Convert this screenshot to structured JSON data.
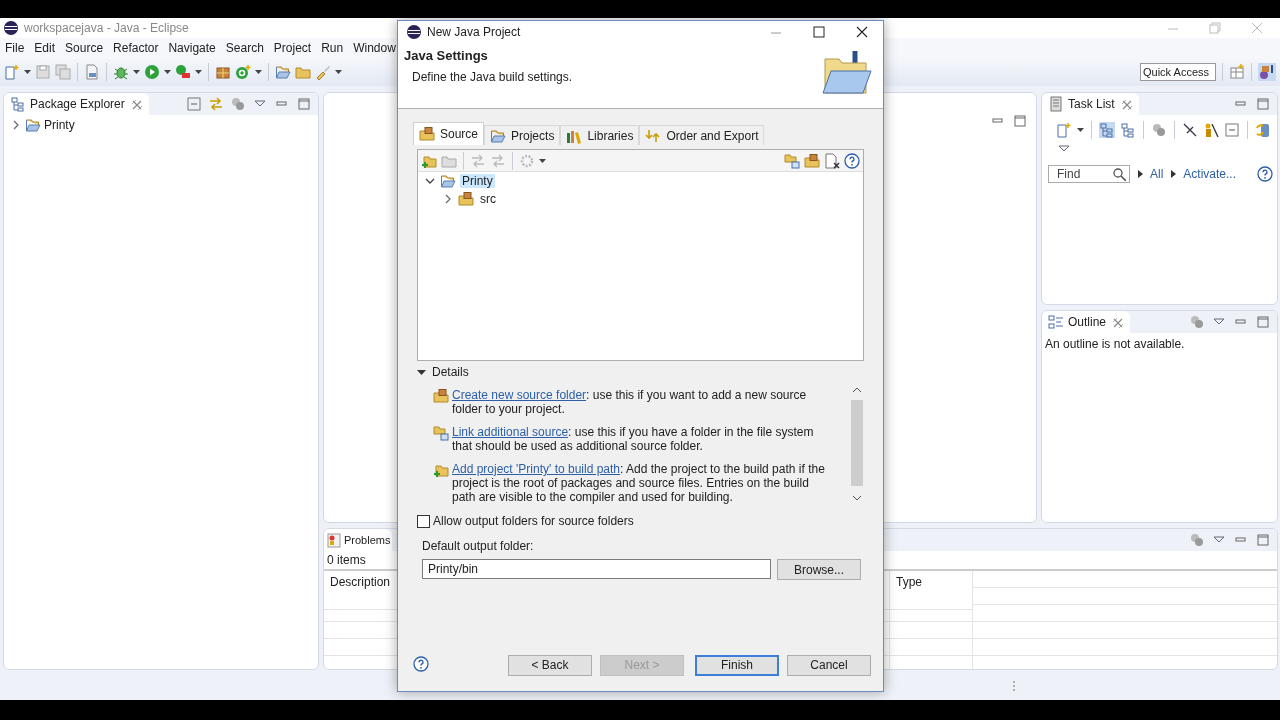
{
  "window": {
    "title": "workspacejava - Java - Eclipse"
  },
  "menu": [
    "File",
    "Edit",
    "Source",
    "Refactor",
    "Navigate",
    "Search",
    "Project",
    "Run",
    "Window"
  ],
  "quick_access": {
    "placeholder": "Quick Access"
  },
  "package_explorer": {
    "title": "Package Explorer",
    "tree": [
      {
        "label": "Printy",
        "expanded": false
      }
    ]
  },
  "task_list": {
    "title": "Task List",
    "find": {
      "placeholder": "Find"
    },
    "links": [
      "All",
      "Activate..."
    ]
  },
  "outline": {
    "title": "Outline",
    "message": "An outline is not available."
  },
  "problems": {
    "title": "Problems",
    "count": "0 items",
    "columns": [
      "Description",
      "Type"
    ]
  },
  "dialog": {
    "title": "New Java Project",
    "heading": "Java Settings",
    "description": "Define the Java build settings.",
    "tabs": [
      {
        "label": "Source",
        "selected": true
      },
      {
        "label": "Projects",
        "selected": false
      },
      {
        "label": "Libraries",
        "selected": false
      },
      {
        "label": "Order and Export",
        "selected": false
      }
    ],
    "tree": [
      {
        "label": "Printy",
        "expanded": true,
        "selected": true,
        "children": [
          {
            "label": "src",
            "expanded": false,
            "selected": false
          }
        ]
      }
    ],
    "details": {
      "title": "Details",
      "expanded": true,
      "items": [
        {
          "link": "Create new source folder",
          "text": ": use this if you want to add a new source folder to your project."
        },
        {
          "link": "Link additional source",
          "text": ": use this if you have a folder in the file system that should be used as additional source folder."
        },
        {
          "link": "Add project 'Printy' to build path",
          "text": ": Add the project to the build path if the project is the root of packages and source files. Entries on the build path are visible to the compiler and used for building."
        }
      ]
    },
    "allow_output": {
      "label": "Allow output folders for source folders",
      "checked": false
    },
    "output_folder": {
      "label": "Default output folder:",
      "value": "Printy/bin"
    },
    "browse": "Browse...",
    "buttons": [
      {
        "label": "< Back",
        "disabled": false,
        "default": false
      },
      {
        "label": "Next >",
        "disabled": true,
        "default": false
      },
      {
        "label": "Finish",
        "disabled": false,
        "default": true
      },
      {
        "label": "Cancel",
        "disabled": false,
        "default": false
      }
    ]
  }
}
